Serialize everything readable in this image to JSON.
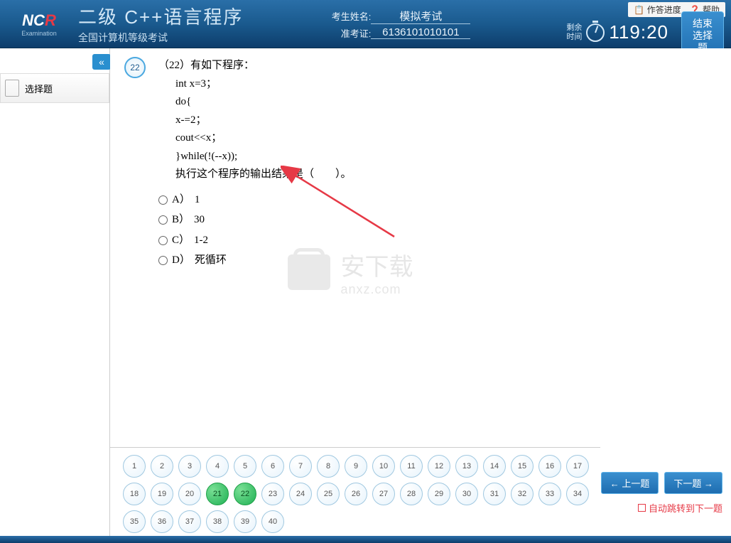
{
  "header": {
    "logo_main": "NCR",
    "logo_sub": "Examination",
    "title_main": "二级  C++语言程序",
    "title_sub": "全国计算机等级考试",
    "name_label": "考生姓名:",
    "name_value": "模拟考试",
    "id_label": "准考证:",
    "id_value": "6136101010101",
    "progress_link": "作答进度",
    "help_link": "帮助",
    "timer_label1": "剩余",
    "timer_label2": "时间",
    "timer_value": "119:20",
    "end_btn_l1": "结束",
    "end_btn_l2": "选择题"
  },
  "sidebar": {
    "item_label": "选择题",
    "collapse_glyph": "«"
  },
  "question": {
    "number": "22",
    "stem_prefix": "（22）有如下程序：",
    "code1": "int x=3；",
    "code2": "do{",
    "code3": "x-=2；",
    "code4": "cout<<x；",
    "code5": "}while(!(--x));",
    "stem_suffix": "执行这个程序的输出结果是（　　）。",
    "options": [
      {
        "label": "A）",
        "text": "1"
      },
      {
        "label": "B）",
        "text": "30"
      },
      {
        "label": "C）",
        "text": "1-2"
      },
      {
        "label": "D）",
        "text": "死循环"
      }
    ]
  },
  "watermark": {
    "cn": "安下载",
    "en": "anxz.com"
  },
  "nav": {
    "total": 40,
    "answered": [
      21,
      22
    ],
    "prev_label": "← 上一题",
    "next_label": "下一题 →",
    "auto_label": "自动跳转到下一题"
  }
}
